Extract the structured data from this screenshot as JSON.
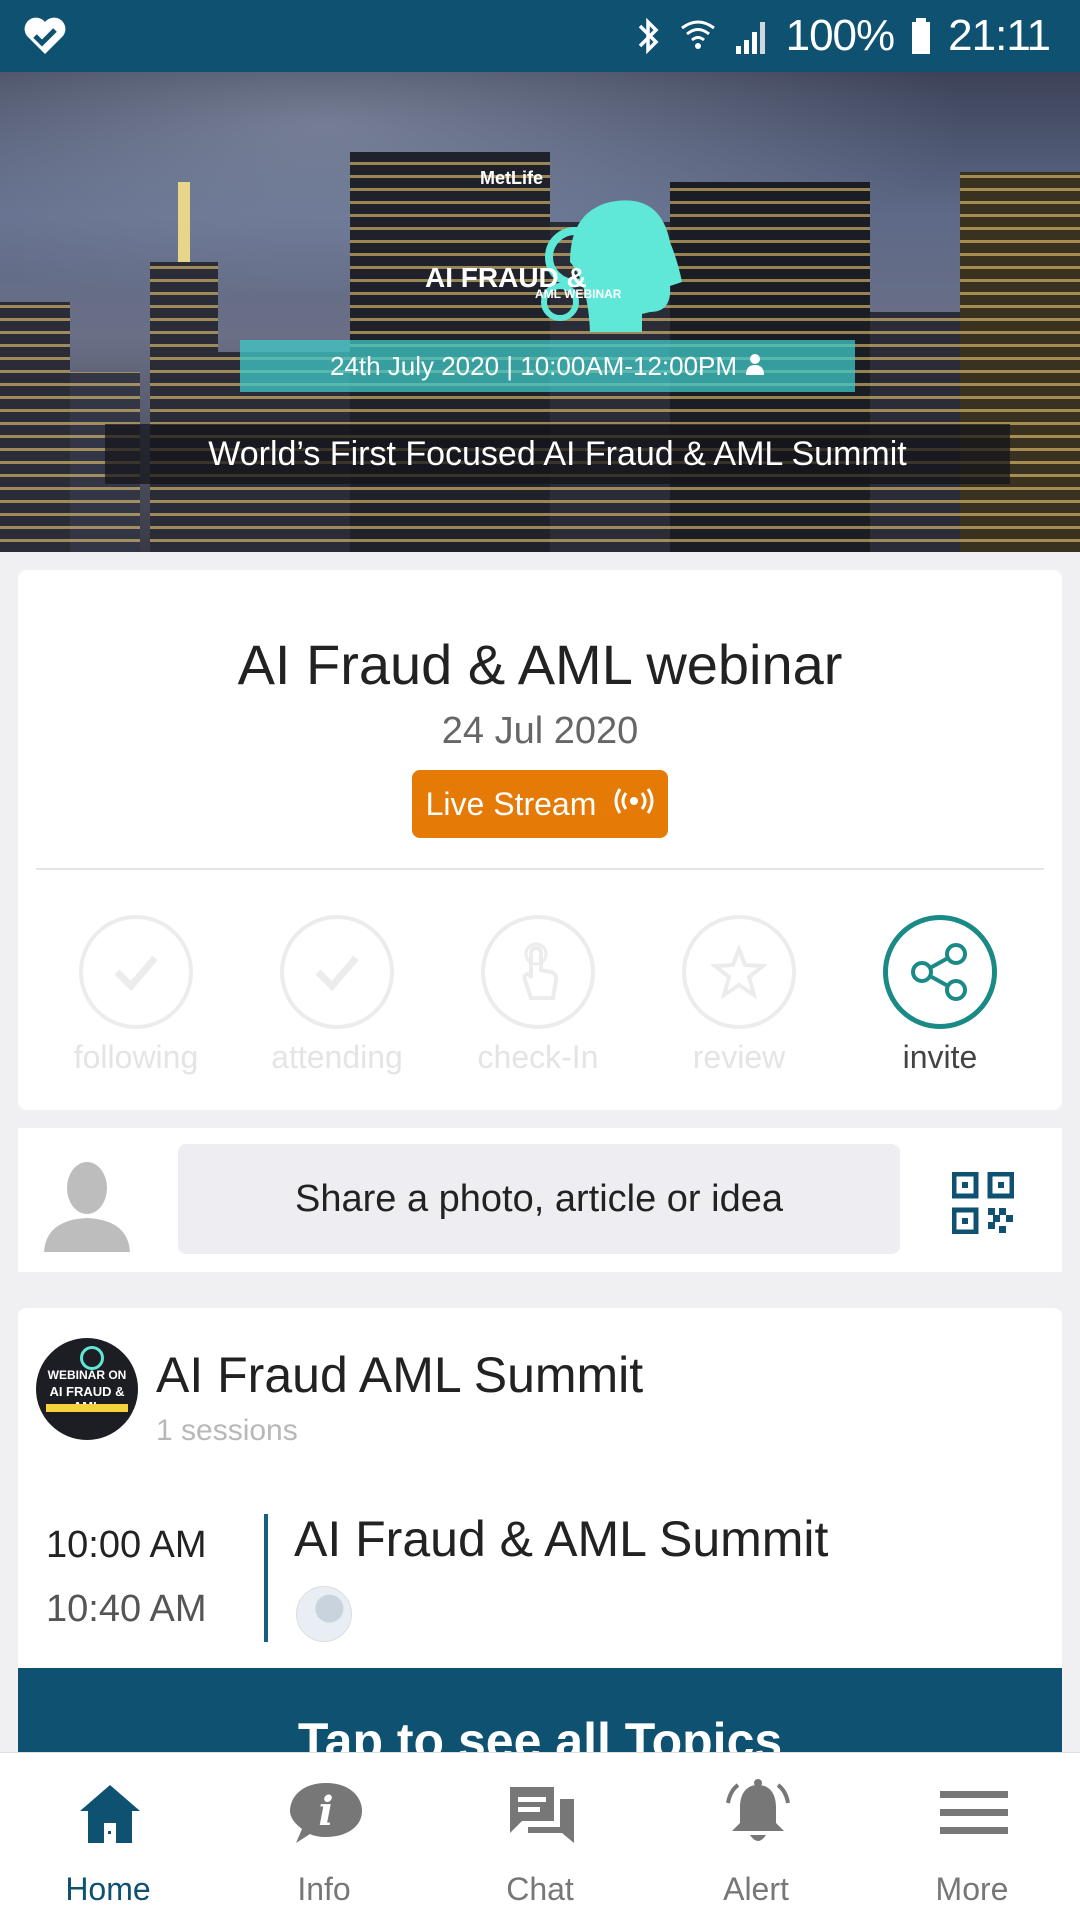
{
  "status_bar": {
    "battery": "100%",
    "time": "21:11"
  },
  "hero": {
    "logo_title": "AI FRAUD &",
    "logo_subtitle": "AML WEBINAR",
    "date_band": "24th July 2020 | 10:00AM-12:00PM",
    "tagline": "World’s First Focused AI Fraud & AML Summit",
    "building_sign": "MetLife"
  },
  "event": {
    "title": "AI Fraud & AML webinar",
    "date": "24 Jul 2020",
    "live_label": "Live Stream"
  },
  "actions": [
    {
      "label": "following",
      "icon": "check-icon",
      "active": false
    },
    {
      "label": "attending",
      "icon": "check-icon",
      "active": false
    },
    {
      "label": "check-In",
      "icon": "tap-hand-icon",
      "active": false
    },
    {
      "label": "review",
      "icon": "star-icon",
      "active": false
    },
    {
      "label": "invite",
      "icon": "share-icon",
      "active": true
    }
  ],
  "composer": {
    "placeholder": "Share a photo, article or idea"
  },
  "summit": {
    "logo_line1": "WEBINAR ON",
    "logo_line2": "AI FRAUD & AML",
    "name": "AI Fraud AML Summit",
    "sessions_count": "1 sessions",
    "session": {
      "start": "10:00 AM",
      "end": "10:40 AM",
      "title": "AI Fraud & AML Summit"
    }
  },
  "topics_button": "Tap to see all Topics",
  "bottom_nav": [
    {
      "label": "Home",
      "icon": "home-icon",
      "active": true
    },
    {
      "label": "Info",
      "icon": "info-icon",
      "active": false
    },
    {
      "label": "Chat",
      "icon": "chat-icon",
      "active": false
    },
    {
      "label": "Alert",
      "icon": "bell-icon",
      "active": false
    },
    {
      "label": "More",
      "icon": "menu-icon",
      "active": false
    }
  ],
  "colors": {
    "primary": "#0f5170",
    "accent_teal": "#1a8a86",
    "live_orange": "#e67a07"
  }
}
